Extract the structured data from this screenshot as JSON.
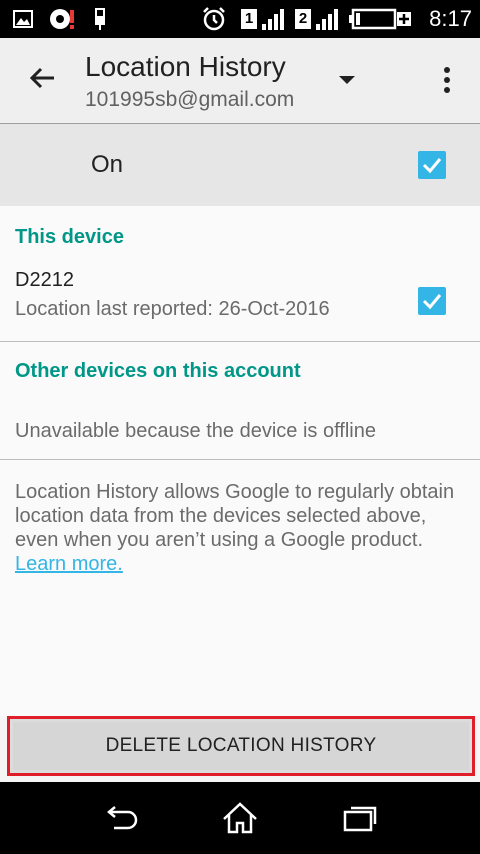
{
  "status_bar": {
    "time": "8:17",
    "sim1": "1",
    "sim2": "2",
    "icons": [
      "image-icon",
      "alert-badge-icon",
      "usb-icon",
      "alarm-icon",
      "signal-icon",
      "battery-charging-icon"
    ]
  },
  "app_bar": {
    "title": "Location History",
    "account": "101995sb@gmail.com",
    "icons": [
      "back-arrow-icon",
      "dropdown-arrow-icon",
      "more-vert-icon"
    ]
  },
  "master_toggle": {
    "label": "On",
    "checked": true
  },
  "this_device": {
    "header": "This device",
    "name": "D2212",
    "last_reported": "Location last reported: 26-Oct-2016",
    "checked": true
  },
  "other_devices": {
    "header": "Other devices on this account",
    "status": "Unavailable because the device is offline"
  },
  "description": {
    "text": "Location History allows Google to regularly obtain location data from the devices selected above, even when you aren’t using a Google product. ",
    "link": "Learn more."
  },
  "delete_button": {
    "label": "DELETE LOCATION HISTORY"
  },
  "nav_bar": {
    "icons": [
      "back-icon",
      "home-icon",
      "recents-icon"
    ]
  },
  "colors": {
    "accent": "#009688",
    "checkbox": "#33b5e5",
    "highlight": "#e01e2a"
  }
}
